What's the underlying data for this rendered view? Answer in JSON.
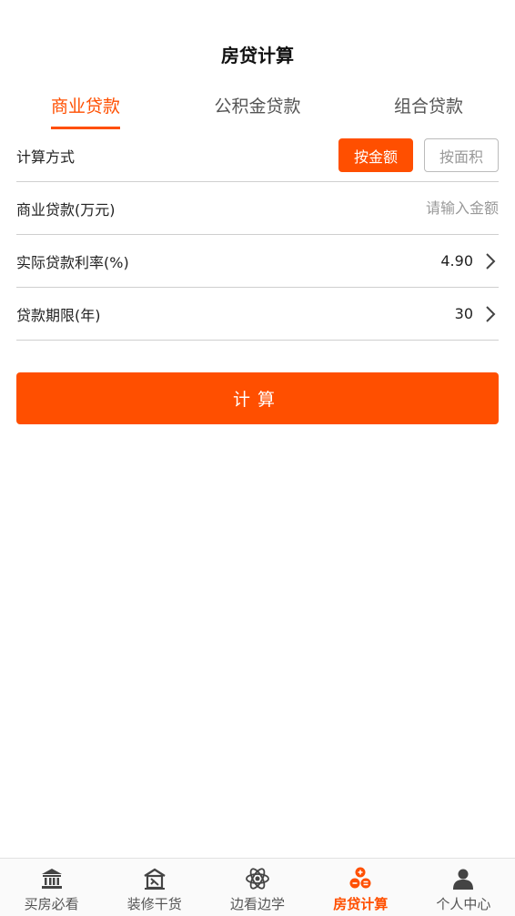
{
  "header": {
    "title": "房贷计算"
  },
  "tabs": [
    {
      "label": "商业贷款",
      "active": true
    },
    {
      "label": "公积金贷款",
      "active": false
    },
    {
      "label": "组合贷款",
      "active": false
    }
  ],
  "form": {
    "method": {
      "label": "计算方式",
      "options": [
        {
          "label": "按金额",
          "selected": true
        },
        {
          "label": "按面积",
          "selected": false
        }
      ]
    },
    "amount": {
      "label": "商业贷款(万元)",
      "placeholder": "请输入金额",
      "value": ""
    },
    "rate": {
      "label": "实际贷款利率(%)",
      "value": "4.90"
    },
    "term": {
      "label": "贷款期限(年)",
      "value": "30"
    }
  },
  "calculate": {
    "label": "计算"
  },
  "nav": {
    "items": [
      {
        "label": "买房必看",
        "icon": "bank-icon",
        "active": false
      },
      {
        "label": "装修干货",
        "icon": "house-tools-icon",
        "active": false
      },
      {
        "label": "边看边学",
        "icon": "atom-icon",
        "active": false
      },
      {
        "label": "房贷计算",
        "icon": "calculator-icon",
        "active": true
      },
      {
        "label": "个人中心",
        "icon": "user-icon",
        "active": false
      }
    ]
  },
  "colors": {
    "accent": "#ff4f00",
    "text": "#222222",
    "muted": "#999999",
    "divider": "#cfcfcf"
  }
}
